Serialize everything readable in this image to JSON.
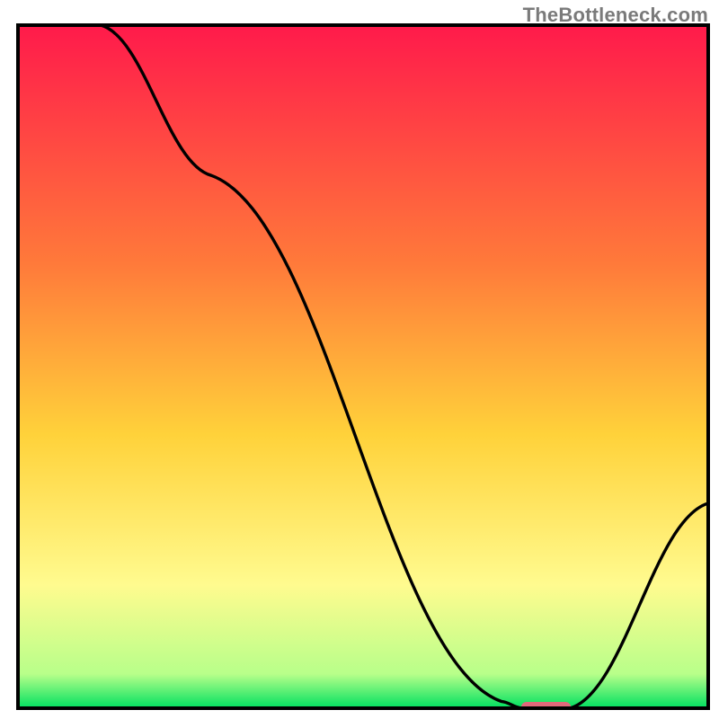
{
  "watermark": "TheBottleneck.com",
  "chart_data": {
    "type": "line",
    "title": "",
    "xlabel": "",
    "ylabel": "",
    "xlim": [
      0,
      100
    ],
    "ylim": [
      0,
      100
    ],
    "grid": false,
    "legend": false,
    "background_gradient": {
      "stops": [
        {
          "offset": 0.0,
          "color": "#ff1a4b"
        },
        {
          "offset": 0.35,
          "color": "#ff7a3a"
        },
        {
          "offset": 0.6,
          "color": "#ffd23a"
        },
        {
          "offset": 0.82,
          "color": "#fffb8f"
        },
        {
          "offset": 0.95,
          "color": "#b8ff8a"
        },
        {
          "offset": 1.0,
          "color": "#00e060"
        }
      ]
    },
    "series": [
      {
        "name": "bottleneck-curve",
        "x": [
          0,
          12,
          28,
          70,
          73,
          80,
          100
        ],
        "y": [
          100,
          100,
          78,
          1,
          0,
          0,
          30
        ]
      }
    ],
    "optimal_marker": {
      "x_center": 76.5,
      "x_halfwidth": 3.6,
      "y": 0,
      "color": "#e0697b"
    }
  },
  "colors": {
    "frame": "#000000",
    "curve": "#000000",
    "marker": "#e0697b"
  }
}
